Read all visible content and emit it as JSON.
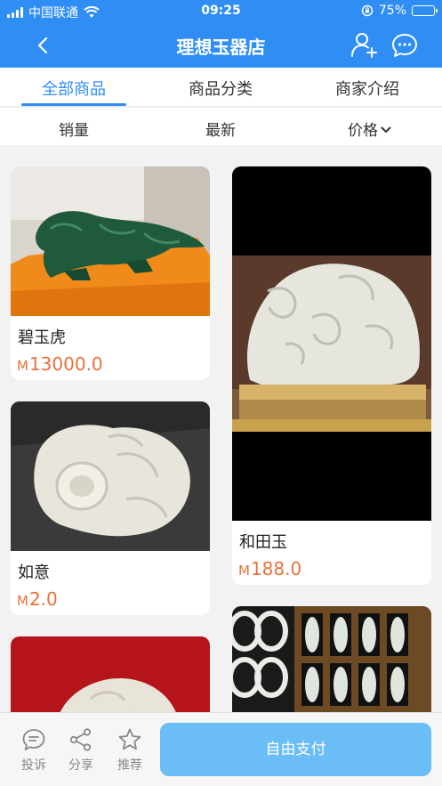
{
  "status_bar": {
    "carrier": "中国联通",
    "time": "09:25",
    "battery_percent": "75%",
    "battery_level": 0.75
  },
  "nav": {
    "title": "理想玉器店",
    "icons": [
      "back-chevron-icon",
      "add-user-icon",
      "chat-bubble-icon"
    ]
  },
  "tabs": [
    {
      "label": "全部商品",
      "active": true
    },
    {
      "label": "商品分类",
      "active": false
    },
    {
      "label": "商家介绍",
      "active": false
    }
  ],
  "sort": {
    "sales": "销量",
    "newest": "最新",
    "price": "价格"
  },
  "products": [
    {
      "name": "碧玉虎",
      "currency": "M",
      "price": "13000.0"
    },
    {
      "name": "和田玉",
      "currency": "M",
      "price": "188.0"
    },
    {
      "name": "如意",
      "currency": "M",
      "price": "2.0"
    },
    {
      "name": "",
      "currency": "",
      "price": ""
    },
    {
      "name": "",
      "currency": "",
      "price": ""
    }
  ],
  "bottom": {
    "complain": "投诉",
    "share": "分享",
    "recommend": "推荐",
    "pay_button": "自由支付"
  },
  "colors": {
    "primary": "#2f8df4",
    "price": "#e8713a",
    "pay_button": "#6bbdf6"
  }
}
